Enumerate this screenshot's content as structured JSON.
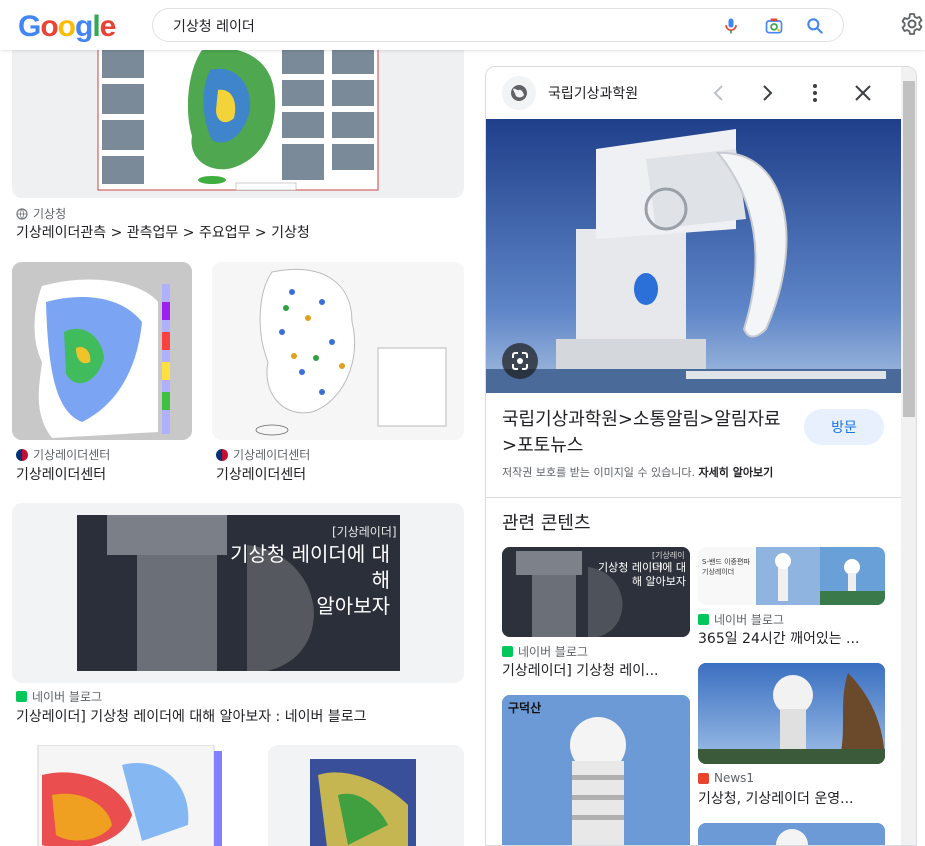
{
  "header": {
    "logo_letters": [
      "G",
      "o",
      "o",
      "g",
      "l",
      "e"
    ],
    "logo_colors": [
      "#4285F4",
      "#EA4335",
      "#FBBC05",
      "#4285F4",
      "#34A853",
      "#EA4335"
    ],
    "search_value": "기상청 레이더"
  },
  "results": {
    "first": {
      "source": "기상청",
      "title": "기상레이더관측 > 관측업무 > 주요업무 > 기상청"
    },
    "row2": [
      {
        "source": "기상레이더센터",
        "title": "기상레이더센터"
      },
      {
        "source": "기상레이더센터",
        "title": "기상레이더센터"
      }
    ],
    "blog": {
      "overlay_small": "[기상레이더]",
      "overlay_line1": "기상청 레이더에 대해",
      "overlay_line2": "알아보자",
      "source": "네이버 블로그",
      "title": "기상레이더] 기상청 레이더에 대해 알아보자 : 네이버 블로그"
    }
  },
  "panel": {
    "site": "국립기상과학원",
    "title": "국립기상과학원>소통알림>알림자료>포토뉴스",
    "visit_label": "방문",
    "copyright_text": "저작권 보호를 받는 이미지일 수 있습니다.",
    "learn_more": "자세히 알아보기",
    "related_heading": "관련 콘텐츠",
    "related": [
      {
        "source": "네이버 블로그",
        "title": "기상레이더] 기상청 레이...",
        "overlay": "기상청 레이더에 대해 알아보자",
        "overlay_small": "[기상레이더]"
      },
      {
        "source": "네이버 블로그",
        "title": "365일 24시간 깨어있는 ...",
        "overlay": "S-밴드 이중편파 기상레이더"
      },
      {
        "source": "",
        "title": "",
        "overlay": "구덕산"
      },
      {
        "source": "News1",
        "title": "기상청, 기상레이더 운영..."
      }
    ]
  },
  "colors": {
    "accent": "#1a73e8",
    "naver": "#03C75A",
    "news1": "#E8452C"
  }
}
